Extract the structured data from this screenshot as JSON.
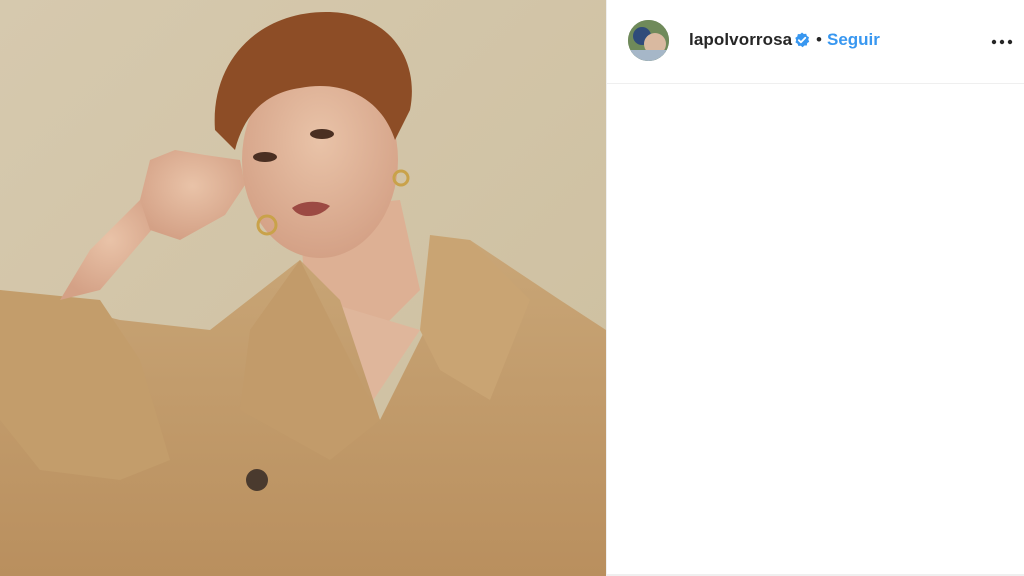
{
  "post": {
    "username": "lapolvorrosa",
    "verified_icon": "verified-badge-icon",
    "separator": "•",
    "follow_label": "Seguir",
    "more_icon": "more-options-icon",
    "photo_subject": "portrait-photo"
  },
  "colors": {
    "follow_blue": "#3897f0",
    "text_dark": "#262626",
    "verified_blue": "#3897f0",
    "divider": "#efefef"
  }
}
